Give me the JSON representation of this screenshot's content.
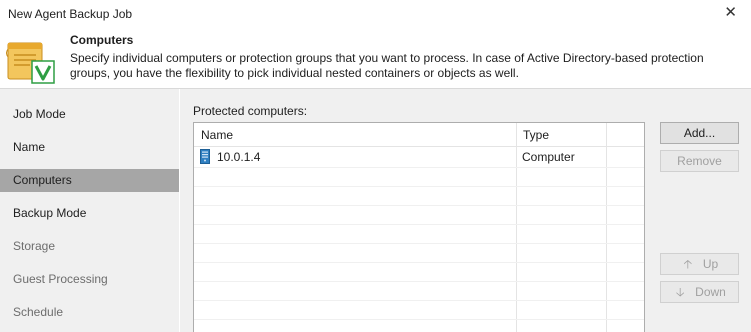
{
  "window": {
    "title": "New Agent Backup Job",
    "close_glyph": "✕"
  },
  "header": {
    "title": "Computers",
    "description": "Specify individual computers or protection groups that you want to process. In case of Active Directory-based protection groups, you have the flexibility to pick individual nested containers or objects as well."
  },
  "sidebar": {
    "items": [
      {
        "label": "Job Mode",
        "state": "normal"
      },
      {
        "label": "Name",
        "state": "normal"
      },
      {
        "label": "Computers",
        "state": "active"
      },
      {
        "label": "Backup Mode",
        "state": "normal"
      },
      {
        "label": "Storage",
        "state": "disabled"
      },
      {
        "label": "Guest Processing",
        "state": "disabled"
      },
      {
        "label": "Schedule",
        "state": "disabled"
      }
    ]
  },
  "protected": {
    "label": "Protected computers:",
    "columns": [
      "Name",
      "Type"
    ],
    "rows": [
      {
        "name": "10.0.1.4",
        "type": "Computer",
        "icon": "server-icon"
      }
    ]
  },
  "buttons": {
    "add": "Add...",
    "remove": "Remove",
    "up": "Up",
    "down": "Down",
    "up_glyph": "🡡",
    "down_glyph": "🡣"
  },
  "colors": {
    "sidebar_bg": "#f0f0f0",
    "active_item": "#a6a6a6",
    "server_icon": "#2f7fc1",
    "logo_scroll": "#f0b640",
    "logo_check": "#2e9e43"
  }
}
